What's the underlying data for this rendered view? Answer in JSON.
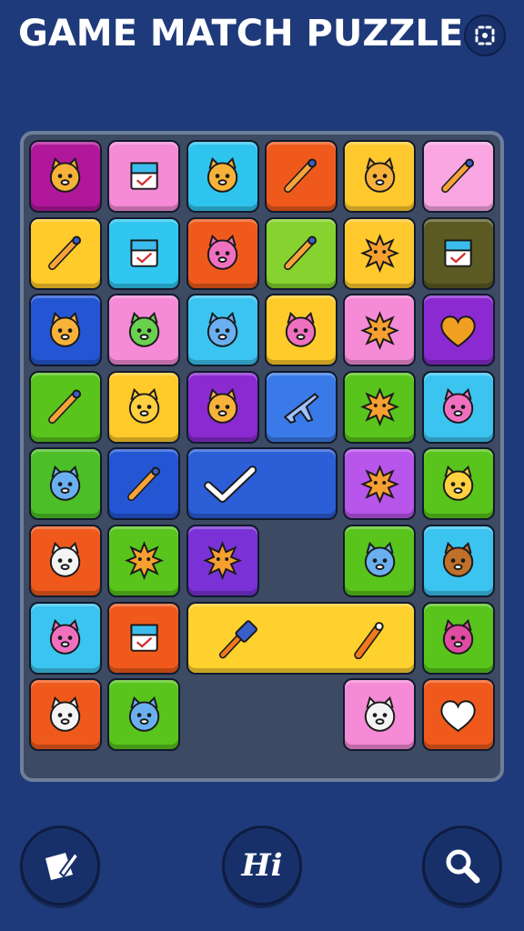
{
  "header": {
    "title": "GAME MATCH PUZZLE",
    "settings_icon": "settings-gear-icon"
  },
  "board": {
    "columns": 6,
    "rows": 8,
    "tiles": [
      {
        "row": 0,
        "col": 0,
        "color": "#b0179a",
        "icon": "lion-face-icon"
      },
      {
        "row": 0,
        "col": 1,
        "color": "#f58ad6",
        "icon": "stacked-blocks-icon"
      },
      {
        "row": 0,
        "col": 2,
        "color": "#2fc4ee",
        "icon": "lemon-bell-icon"
      },
      {
        "row": 0,
        "col": 3,
        "color": "#ef5a1c",
        "icon": "crayon-icon"
      },
      {
        "row": 0,
        "col": 4,
        "color": "#ffc92e",
        "icon": "balloon-cat-icon"
      },
      {
        "row": 0,
        "col": 5,
        "color": "#f9a6e2",
        "icon": "paintbrush-icon"
      },
      {
        "row": 1,
        "col": 0,
        "color": "#ffcb2a",
        "icon": "crossed-pencils-icon"
      },
      {
        "row": 1,
        "col": 1,
        "color": "#31c6f0",
        "icon": "checklist-icon"
      },
      {
        "row": 1,
        "col": 2,
        "color": "#ef5a1c",
        "icon": "pink-cat-icon"
      },
      {
        "row": 1,
        "col": 3,
        "color": "#86d22e",
        "icon": "crossed-tools-icon"
      },
      {
        "row": 1,
        "col": 4,
        "color": "#ffc92e",
        "icon": "green-spiky-creature-icon"
      },
      {
        "row": 1,
        "col": 5,
        "color": "#5b5a22",
        "icon": "calendar-grid-icon"
      },
      {
        "row": 2,
        "col": 0,
        "color": "#2456d4",
        "icon": "fox-face-icon"
      },
      {
        "row": 2,
        "col": 1,
        "color": "#f58ad6",
        "icon": "green-cat-icon"
      },
      {
        "row": 2,
        "col": 2,
        "color": "#3cc4f0",
        "icon": "blue-bear-icon"
      },
      {
        "row": 2,
        "col": 3,
        "color": "#ffcb2a",
        "icon": "pink-bear-icon"
      },
      {
        "row": 2,
        "col": 4,
        "color": "#f58ad6",
        "icon": "sun-creature-icon"
      },
      {
        "row": 2,
        "col": 5,
        "color": "#8a2ad0",
        "icon": "orange-heart-icon"
      },
      {
        "row": 3,
        "col": 0,
        "color": "#58c41c",
        "icon": "magnifier-lollipop-icon"
      },
      {
        "row": 3,
        "col": 1,
        "color": "#ffcb2a",
        "icon": "yellow-cat-icon"
      },
      {
        "row": 3,
        "col": 2,
        "color": "#8a2ad0",
        "icon": "orange-lion-icon"
      },
      {
        "row": 3,
        "col": 3,
        "color": "#3a7ae8",
        "icon": "airplane-icon"
      },
      {
        "row": 3,
        "col": 4,
        "color": "#58c41c",
        "icon": "starburst-sign-icon"
      },
      {
        "row": 3,
        "col": 5,
        "color": "#3cc4f0",
        "icon": "pink-hippo-icon"
      },
      {
        "row": 4,
        "col": 0,
        "color": "#4cbf28",
        "icon": "blue-cat-icon"
      },
      {
        "row": 4,
        "col": 1,
        "color": "#2456d4",
        "icon": "screwdriver-icon"
      },
      {
        "row": 4,
        "col": 2,
        "span": 2,
        "color": "#2c5ed8",
        "icon": "checkmark-icon"
      },
      {
        "row": 4,
        "col": 4,
        "color": "#b855ea",
        "icon": "orange-sun-icon"
      },
      {
        "row": 4,
        "col": 5,
        "color": "#58c41c",
        "icon": "yellow-cat-face-icon"
      },
      {
        "row": 5,
        "col": 0,
        "color": "#ef5a1c",
        "icon": "white-lion-icon"
      },
      {
        "row": 5,
        "col": 1,
        "color": "#58c41c",
        "icon": "green-urchin-icon"
      },
      {
        "row": 5,
        "col": 2,
        "color": "#7a32d6",
        "icon": "green-spiky-ball-icon"
      },
      {
        "row": 5,
        "col": 4,
        "color": "#58c41c",
        "icon": "blue-fish-creature-icon"
      },
      {
        "row": 5,
        "col": 5,
        "color": "#3cc4f0",
        "icon": "brown-cat-icon"
      },
      {
        "row": 6,
        "col": 0,
        "color": "#3cc4f0",
        "icon": "pink-lion-icon"
      },
      {
        "row": 6,
        "col": 1,
        "color": "#ef5a1c",
        "icon": "blank-card-icon"
      },
      {
        "row": 6,
        "col": 2,
        "span": 3,
        "color": "#ffd12e",
        "icon": "hammer-and-marker-icon"
      },
      {
        "row": 6,
        "col": 5,
        "color": "#58c41c",
        "icon": "magenta-cat-icon"
      },
      {
        "row": 7,
        "col": 0,
        "color": "#ef5a1c",
        "icon": "white-cat-icon"
      },
      {
        "row": 7,
        "col": 1,
        "color": "#58c41c",
        "icon": "blue-mouse-icon"
      },
      {
        "row": 7,
        "col": 4,
        "color": "#f58ad6",
        "icon": "white-kitten-icon"
      },
      {
        "row": 7,
        "col": 5,
        "color": "#ef5a1c",
        "icon": "white-heart-icon"
      }
    ]
  },
  "controls": {
    "left_icon": "edit-card-icon",
    "hint_label": "Hi",
    "right_icon": "search-icon"
  },
  "colors": {
    "background": "#1f3a7a",
    "board": "#3d4a63",
    "board_border": "#6e7f9a"
  }
}
